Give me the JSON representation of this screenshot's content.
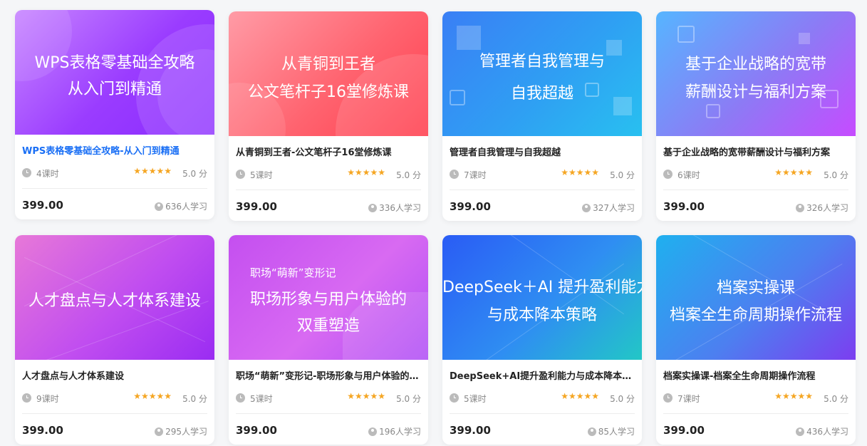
{
  "courses": [
    {
      "cover_lines": [
        "WPS表格零基础全攻略",
        "从入门到精通"
      ],
      "title": "WPS表格零基础全攻略-从入门到精通",
      "lessons": "4课时",
      "rating": "5.0 分",
      "price": "399.00",
      "learners": "636人学习",
      "gradient": [
        "#c17cff",
        "#8a2bff"
      ]
    },
    {
      "cover_lines": [
        "从青铜到王者",
        "公文笔杆子16堂修炼课"
      ],
      "title": "从青铜到王者-公文笔杆子16堂修炼课",
      "lessons": "5课时",
      "rating": "5.0 分",
      "price": "399.00",
      "learners": "336人学习",
      "gradient": [
        "#ff8a9a",
        "#ff4453"
      ]
    },
    {
      "cover_lines": [
        "管理者自我管理与",
        "自我超越"
      ],
      "title": "管理者自我管理与自我超越",
      "lessons": "7课时",
      "rating": "5.0 分",
      "price": "399.00",
      "learners": "327人学习",
      "gradient": [
        "#3b8bff",
        "#23b6f2"
      ]
    },
    {
      "cover_lines": [
        "基于企业战略的宽带",
        "薪酬设计与福利方案"
      ],
      "title": "基于企业战略的宽带薪酬设计与福利方案",
      "lessons": "6课时",
      "rating": "5.0 分",
      "price": "399.00",
      "learners": "326人学习",
      "gradient": [
        "#5aa8ff",
        "#c24dff"
      ]
    },
    {
      "cover_lines": [
        "人才盘点与人才体系建设"
      ],
      "title": "人才盘点与人才体系建设",
      "lessons": "9课时",
      "rating": "5.0 分",
      "price": "399.00",
      "learners": "295人学习",
      "gradient": [
        "#e472d6",
        "#9c2bf0"
      ]
    },
    {
      "cover_small": "职场“萌新”变形记",
      "cover_lines": [
        "职场形象与用户体验的",
        "双重塑造"
      ],
      "title": "职场“萌新”变形记-职场形象与用户体验的双重塑造",
      "lessons": "5课时",
      "rating": "5.0 分",
      "price": "399.00",
      "learners": "196人学习",
      "gradient": [
        "#d25cf0",
        "#a03cf5"
      ]
    },
    {
      "cover_lines": [
        "DeepSeek＋AI 提升盈利能力",
        "与成本降本策略"
      ],
      "title": "DeepSeek+AI提升盈利能力与成本降本策略",
      "lessons": "5课时",
      "rating": "5.0 分",
      "price": "399.00",
      "learners": "85人学习",
      "gradient": [
        "#2a6cf3",
        "#22c3c9"
      ]
    },
    {
      "cover_lines": [
        "档案实操课",
        "档案全生命周期操作流程"
      ],
      "title": "档案实操课-档案全生命周期操作流程",
      "lessons": "7课时",
      "rating": "5.0 分",
      "price": "399.00",
      "learners": "436人学习",
      "gradient": [
        "#2aa6f0",
        "#7a3ef0"
      ]
    }
  ],
  "stars": "★★★★★",
  "colors": {
    "active_title": "#1a6ff5",
    "star": "#f5a623"
  }
}
